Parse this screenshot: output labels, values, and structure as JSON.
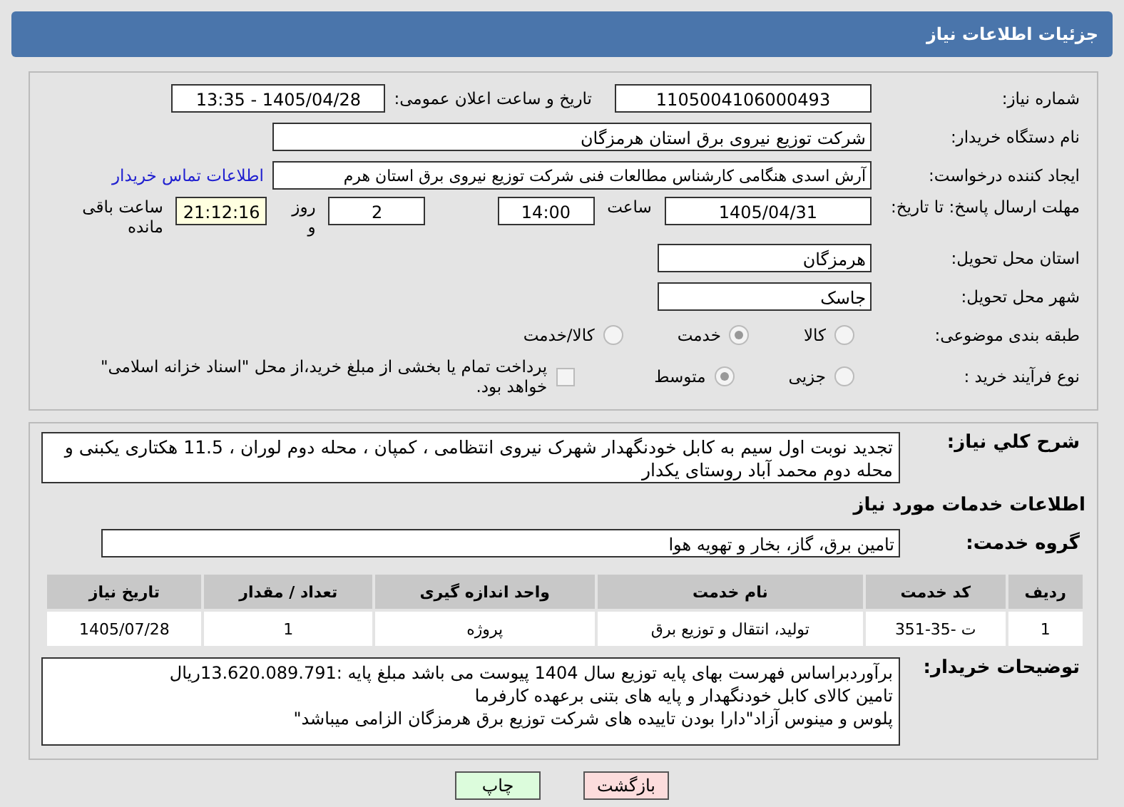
{
  "header": {
    "title": "جزئیات اطلاعات نیاز"
  },
  "need_number": {
    "label": "شماره نیاز:",
    "value": "1105004106000493"
  },
  "announce": {
    "label": "تاریخ و ساعت اعلان عمومی:",
    "value": "1405/04/28 - 13:35"
  },
  "buyer_org": {
    "label": "نام دستگاه خریدار:",
    "value": "شرکت توزیع نیروی برق استان هرمزگان"
  },
  "creator": {
    "label": "ایجاد کننده درخواست:",
    "value": "آرش اسدی هنگامی کارشناس مطالعات فنی شرکت توزیع نیروی برق استان هرم",
    "link": "اطلاعات تماس خریدار"
  },
  "deadline": {
    "label": "مهلت ارسال پاسخ: تا تاریخ:",
    "date": "1405/04/31",
    "time_label": "ساعت",
    "time": "14:00",
    "days": "2",
    "days_label": "روز و",
    "remaining": "21:12:16",
    "remaining_label": "ساعت باقی مانده"
  },
  "province": {
    "label": "استان محل تحویل:",
    "value": "هرمزگان"
  },
  "city": {
    "label": "شهر محل تحویل:",
    "value": "جاسک"
  },
  "category": {
    "label": "طبقه بندی موضوعی:",
    "options": [
      {
        "label": "کالا",
        "selected": false
      },
      {
        "label": "خدمت",
        "selected": true
      },
      {
        "label": "کالا/خدمت",
        "selected": false
      }
    ]
  },
  "process": {
    "label": "نوع فرآیند خرید :",
    "options": [
      {
        "label": "جزیی",
        "selected": false
      },
      {
        "label": "متوسط",
        "selected": true
      }
    ],
    "payment": {
      "checked": false,
      "label": "پرداخت تمام یا بخشی از مبلغ خرید،از محل \"اسناد خزانه اسلامی\" خواهد بود."
    }
  },
  "summary": {
    "label": "شرح كلي نیاز:",
    "value": "تجدید نوبت اول سیم به کابل خودنگهدار شهرک نیروی انتظامی ، کمپان ، محله دوم لوران ، 11.5 هکتاری یکبنی و محله دوم محمد آباد روستای یکدار"
  },
  "services_heading": "اطلاعات خدمات مورد نیاز",
  "service_group": {
    "label": "گروه خدمت:",
    "value": "تامین برق، گاز، بخار و تهویه هوا"
  },
  "table": {
    "columns": [
      "ردیف",
      "کد خدمت",
      "نام خدمت",
      "واحد اندازه گیری",
      "تعداد / مقدار",
      "تاریخ نیاز"
    ],
    "rows": [
      [
        "1",
        "ت -35-351",
        "تولید، انتقال و توزیع برق",
        "پروژه",
        "1",
        "1405/07/28"
      ]
    ]
  },
  "buyer_notes": {
    "label": "توضیحات خریدار:",
    "lines": [
      "برآوردبراساس فهرست بهای پایه توزیع سال 1404 پیوست می باشد مبلغ پایه :13.620.089.791ریال",
      "تامین کالای کابل خودنگهدار و پایه های بتنی برعهده کارفرما",
      "پلوس و مینوس آزاد\"دارا بودن تاییده های شرکت توزیع برق هرمزگان الزامی میباشد\""
    ]
  },
  "buttons": [
    {
      "label": "بازگشت",
      "kind": "back"
    },
    {
      "label": "چاپ",
      "kind": "print"
    }
  ]
}
